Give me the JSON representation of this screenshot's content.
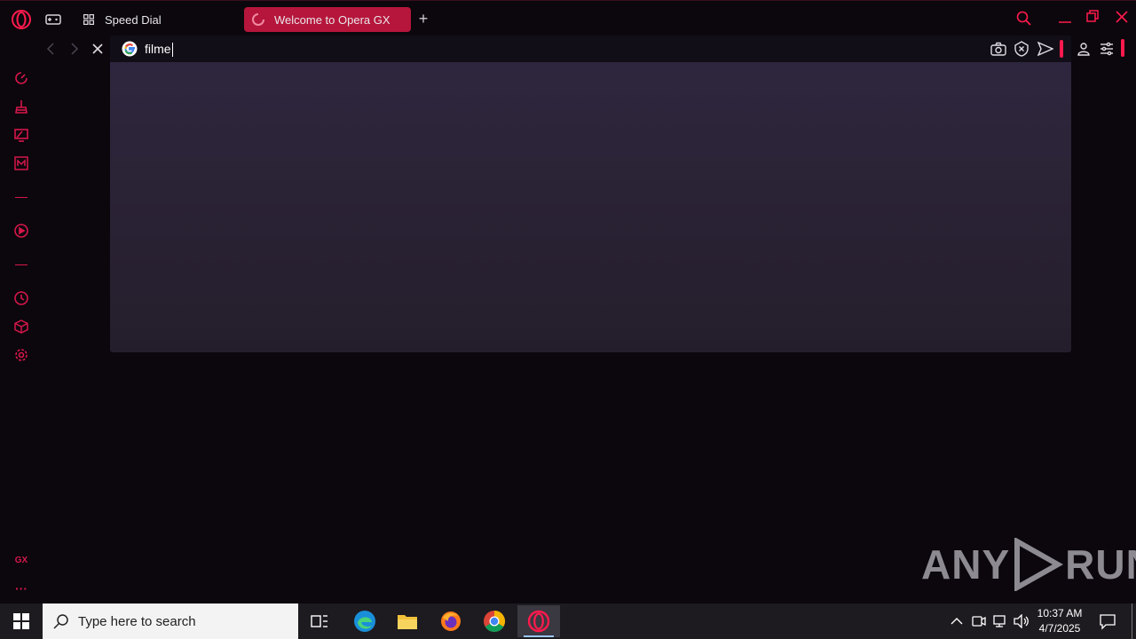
{
  "browser": {
    "tabs": [
      {
        "label": "Speed Dial",
        "icon": "grid-icon",
        "active": false
      },
      {
        "label": "Welcome to Opera GX",
        "icon": "loading-spinner-icon",
        "active": true
      }
    ],
    "new_tab_label": "+"
  },
  "address_bar": {
    "value": "filme",
    "engine_icon": "google-icon"
  },
  "sidebar": {
    "items": [
      "gx-control-icon",
      "gx-cleaner-icon",
      "twitch-icon",
      "gx-mods-icon",
      "player-icon",
      "history-icon",
      "extensions-icon",
      "settings-icon"
    ],
    "gx_label": "GX",
    "more_label": "···"
  },
  "taskbar": {
    "search_placeholder": "Type here to search",
    "time": "10:37 AM",
    "date": "4/7/2025"
  },
  "watermark": {
    "text_left": "ANY",
    "text_right": "RUN"
  },
  "colors": {
    "accent": "#ff1a4d",
    "tab_active": "#b6163b",
    "background": "#0b070d"
  }
}
